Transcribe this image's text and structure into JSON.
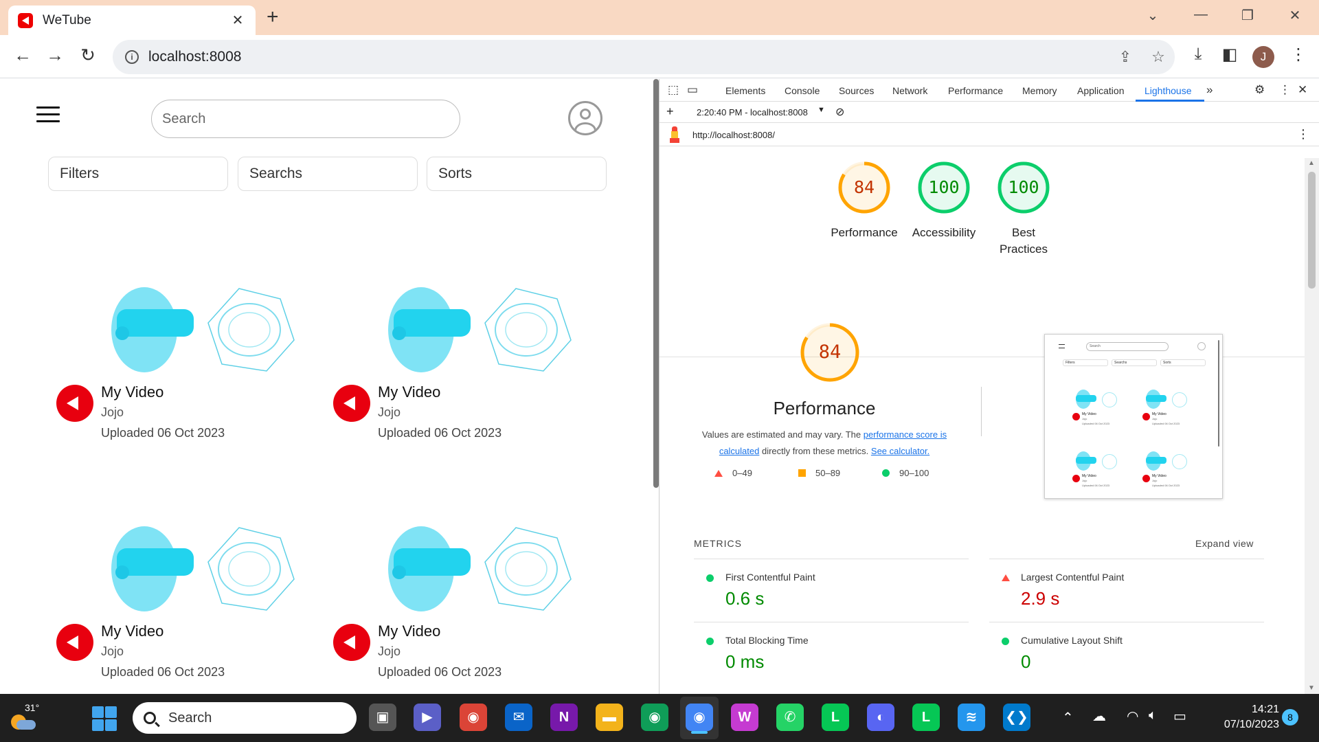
{
  "browser": {
    "tab_title": "WeTube",
    "url": "localhost:8008"
  },
  "page": {
    "search_placeholder": "Search",
    "filters": [
      "Filters",
      "Searchs",
      "Sorts"
    ],
    "videos": [
      {
        "title": "My Video",
        "channel": "Jojo",
        "uploaded": "Uploaded 06 Oct 2023"
      },
      {
        "title": "My Video",
        "channel": "Jojo",
        "uploaded": "Uploaded 06 Oct 2023"
      },
      {
        "title": "My Video",
        "channel": "Jojo",
        "uploaded": "Uploaded 06 Oct 2023"
      },
      {
        "title": "My Video",
        "channel": "Jojo",
        "uploaded": "Uploaded 06 Oct 2023"
      }
    ]
  },
  "devtools": {
    "tabs": [
      "Elements",
      "Console",
      "Sources",
      "Network",
      "Performance",
      "Memory",
      "Application",
      "Lighthouse"
    ],
    "active_tab": "Lighthouse",
    "report_selector": "2:20:40 PM - localhost:8008",
    "report_url": "http://localhost:8008/",
    "scores": [
      {
        "label": "Performance",
        "value": 84,
        "color": "#fa3",
        "text_color": "#c33300"
      },
      {
        "label": "Accessibility",
        "value": 100,
        "color": "#0c6",
        "text_color": "#008a00"
      },
      {
        "label": "Best Practices",
        "value": 100,
        "color": "#0c6",
        "text_color": "#008a00"
      }
    ],
    "perf_detail": {
      "score": 84,
      "label": "Performance",
      "desc_prefix": "Values are estimated and may vary. The ",
      "link1": "performance score is calculated",
      "desc_mid": " directly from these metrics. ",
      "link2": "See calculator."
    },
    "legend": [
      "0–49",
      "50–89",
      "90–100"
    ],
    "metrics_title": "METRICS",
    "expand_view": "Expand view",
    "metrics": [
      {
        "label": "First Contentful Paint",
        "value": "0.6 s",
        "status": "good"
      },
      {
        "label": "Largest Contentful Paint",
        "value": "2.9 s",
        "status": "poor"
      },
      {
        "label": "Total Blocking Time",
        "value": "0 ms",
        "status": "good"
      },
      {
        "label": "Cumulative Layout Shift",
        "value": "0",
        "status": "good"
      }
    ],
    "screenshot_preview": {
      "search": "Search",
      "filters": [
        "Filters",
        "Searchs",
        "Sorts"
      ],
      "video_title": "My Video",
      "channel": "Jojo",
      "uploaded": "Uploaded 06 Oct 2023"
    }
  },
  "taskbar": {
    "temperature": "31°",
    "search_label": "Search",
    "time": "14:21",
    "date": "07/10/2023",
    "notifications": "8"
  },
  "colors": {
    "good": "#0cce6b",
    "average": "#ffa400",
    "poor": "#ff4e42",
    "good_text": "#008a00",
    "poor_text": "#cc0000",
    "link": "#1a73e8",
    "brand_red": "#e8000f"
  }
}
